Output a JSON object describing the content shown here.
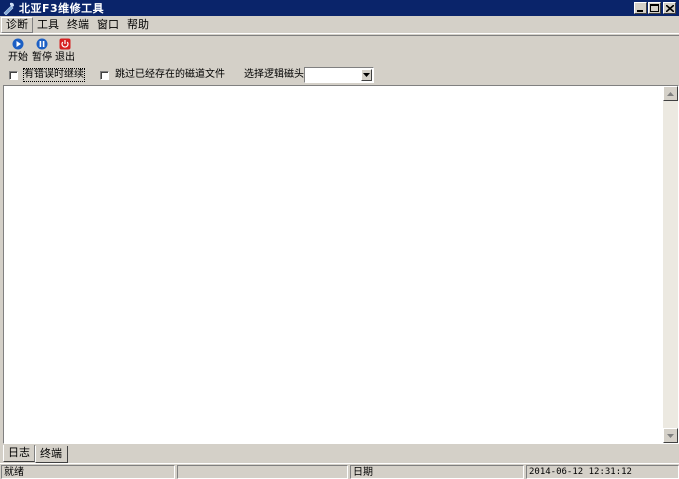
{
  "window": {
    "title": "北亚F3维修工具",
    "controls": [
      "minimize",
      "maximize",
      "close"
    ]
  },
  "menubar": {
    "items": [
      {
        "label": "诊断"
      },
      {
        "label": "工具"
      },
      {
        "label": "终端"
      },
      {
        "label": "窗口"
      },
      {
        "label": "帮助"
      }
    ]
  },
  "toolbar": {
    "start_label": "开始",
    "pause_label": "暂停",
    "exit_label": "退出",
    "colors": {
      "start": "#1c5fc4",
      "pause": "#1c5fc4",
      "exit": "#d62020"
    }
  },
  "options": {
    "continue_on_error_label": "有错误时继续",
    "skip_existing_label": "跳过已经存在的磁道文件",
    "select_head_label": "选择逻辑磁头:",
    "select_head_value": ""
  },
  "tabs": {
    "log_label": "日志",
    "terminal_label": "终端",
    "active": "终端"
  },
  "statusbar": {
    "status": "就绪",
    "pane2": "",
    "date_label": "日期",
    "datetime": "2014-06-12 12:31:12"
  }
}
